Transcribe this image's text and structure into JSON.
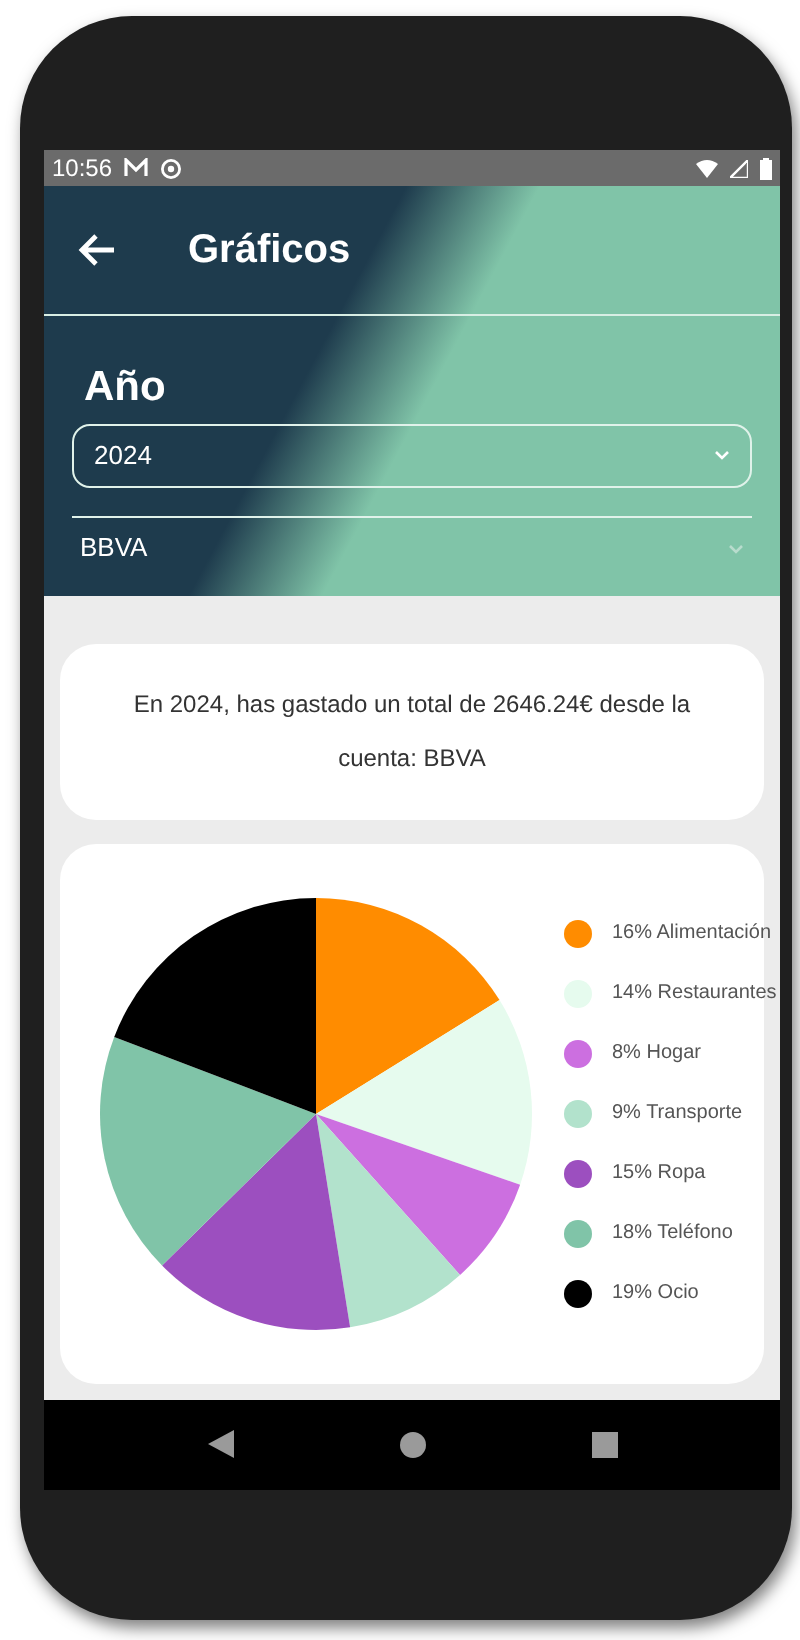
{
  "status_bar": {
    "time": "10:56"
  },
  "toolbar": {
    "title": "Gráficos"
  },
  "filters": {
    "year_label": "Año",
    "year_value": "2024",
    "account_value": "BBVA"
  },
  "summary": {
    "text": "En 2024, has gastado un total de 2646.24€ desde la cuenta: BBVA"
  },
  "chart": {
    "chart_data": {
      "type": "pie",
      "categories": [
        "Alimentación",
        "Restaurantes",
        "Hogar",
        "Transporte",
        "Ropa",
        "Teléfono",
        "Ocio"
      ],
      "values": [
        16,
        14,
        8,
        9,
        15,
        18,
        19
      ],
      "colors": [
        "#ff8c00",
        "#e6fbee",
        "#cc6fe0",
        "#b2e2cc",
        "#9c4fbf",
        "#80c4a8",
        "#000000"
      ]
    },
    "legend": [
      {
        "percent": "16%"
      },
      {
        "percent": "14%"
      },
      {
        "percent": "8%"
      },
      {
        "percent": "9%"
      },
      {
        "percent": "15%"
      },
      {
        "percent": "18%"
      },
      {
        "percent": "19%"
      }
    ]
  }
}
